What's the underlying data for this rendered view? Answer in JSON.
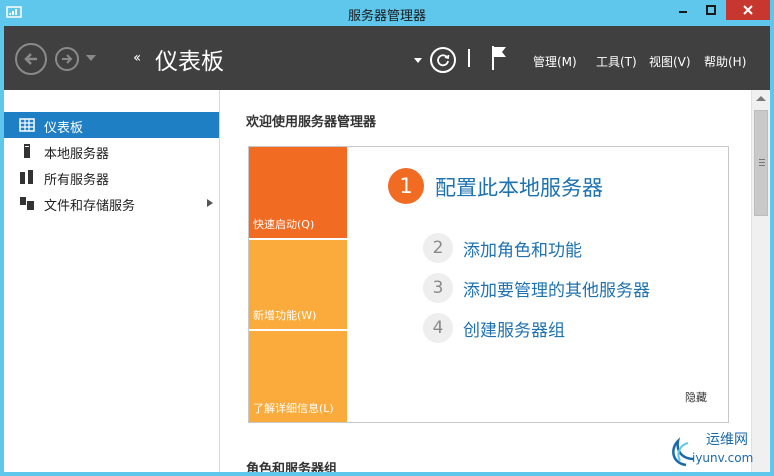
{
  "window": {
    "title": "服务器管理器"
  },
  "header": {
    "breadcrumb_arrows": "‹‹",
    "breadcrumb_title": "仪表板",
    "menus": [
      {
        "label": "管理(M)"
      },
      {
        "label": "工具(T)"
      },
      {
        "label": "视图(V)"
      },
      {
        "label": "帮助(H)"
      }
    ]
  },
  "sidebar": {
    "items": [
      {
        "label": "仪表板",
        "icon": "dashboard-icon",
        "active": true
      },
      {
        "label": "本地服务器",
        "icon": "local-server-icon",
        "active": false
      },
      {
        "label": "所有服务器",
        "icon": "all-servers-icon",
        "active": false
      },
      {
        "label": "文件和存储服务",
        "icon": "file-storage-icon",
        "active": false,
        "has_submenu": true
      }
    ]
  },
  "main": {
    "welcome_title": "欢迎使用服务器管理器",
    "tiles": [
      {
        "label": "快速启动(Q)",
        "color": "#f26b22"
      },
      {
        "label": "新增功能(W)",
        "color": "#fbab3c"
      },
      {
        "label": "了解详细信息(L)",
        "color": "#fbab3c"
      }
    ],
    "steps": [
      {
        "number": "1",
        "text": "配置此本地服务器"
      },
      {
        "number": "2",
        "text": "添加角色和功能"
      },
      {
        "number": "3",
        "text": "添加要管理的其他服务器"
      },
      {
        "number": "4",
        "text": "创建服务器组"
      }
    ],
    "hide_label": "隐藏",
    "section2_title": "角色和服务器组"
  },
  "watermark": {
    "line1": "运维网",
    "line2": "iyunv.com"
  },
  "colors": {
    "titlebar": "#5fc6ec",
    "header": "#404040",
    "accent_blue": "#1e7fc4",
    "link_blue": "#1e72b0",
    "orange": "#f26b22",
    "light_orange": "#fbab3c",
    "close_red": "#c7372f"
  }
}
